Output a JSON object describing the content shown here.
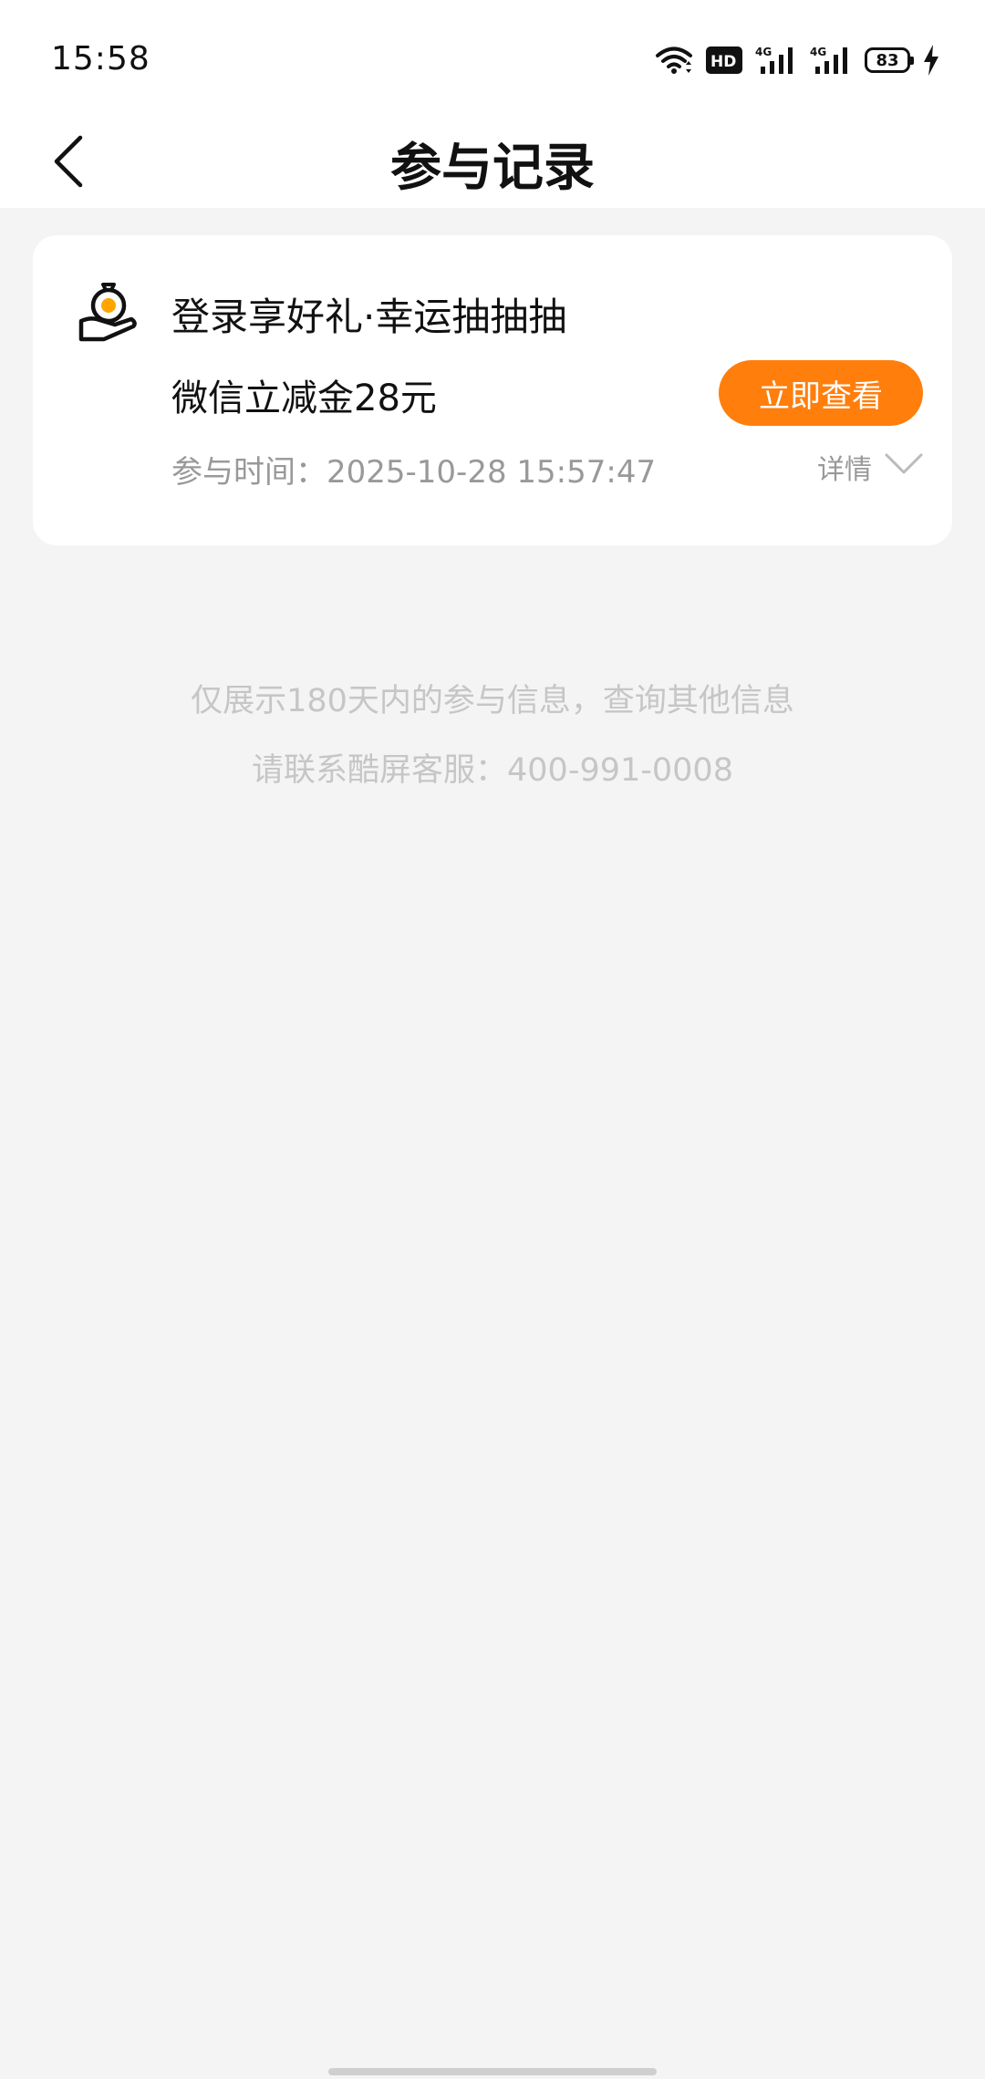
{
  "status_bar": {
    "time": "15:58",
    "icons": [
      "wifi-icon",
      "hd-icon",
      "signal-4g-icon",
      "signal-4g-icon",
      "battery-icon",
      "charging-icon"
    ],
    "network_label_1": "4G",
    "network_label_2": "4G",
    "hd_label": "HD",
    "battery_level": "83"
  },
  "header": {
    "title": "参与记录",
    "back_icon": "chevron-left-icon"
  },
  "record": {
    "icon": "prize-hand-icon",
    "title": "登录享好礼·幸运抽抽抽",
    "prize": "微信立减金28元",
    "view_button_label": "立即查看",
    "time_text": "参与时间：2025-10-28 15:57:47",
    "detail_label": "详情",
    "detail_icon": "chevron-down-icon"
  },
  "notice": {
    "line1": "仅展示180天内的参与信息，查询其他信息",
    "line2": "请联系酷屏客服：400-991-0008"
  },
  "colors": {
    "accent": "#ff7e0c",
    "background": "#f4f4f4",
    "card": "#ffffff",
    "muted_text": "#999999",
    "notice_text": "#c6c6c6"
  }
}
